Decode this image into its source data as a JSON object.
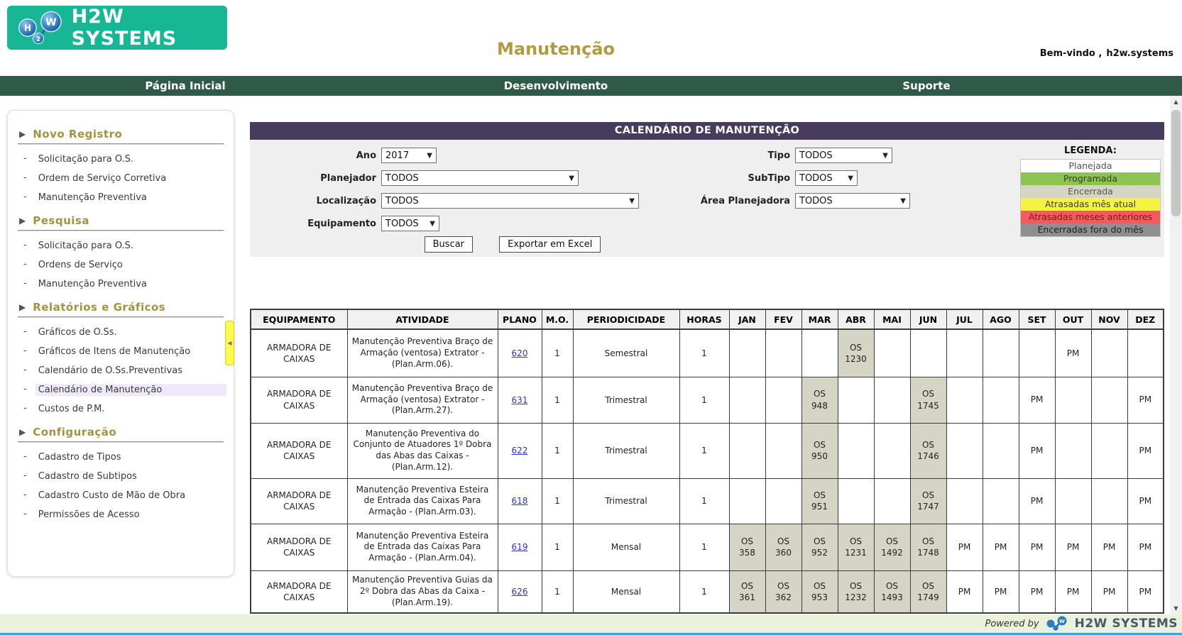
{
  "header": {
    "logo_text": "H2W SYSTEMS",
    "title": "Manutenção",
    "welcome_label": "Bem-vindo ,",
    "username": "h2w.systems"
  },
  "nav": {
    "items": [
      "Página Inicial",
      "Desenvolvimento",
      "Suporte"
    ]
  },
  "sidebar": {
    "sections": [
      {
        "title": "Novo Registro",
        "items": [
          "Solicitação para O.S.",
          "Ordem de Serviço Corretiva",
          "Manutenção Preventiva"
        ]
      },
      {
        "title": "Pesquisa",
        "items": [
          "Solicitação para O.S.",
          "Ordens de Serviço",
          "Manutenção Preventiva"
        ]
      },
      {
        "title": "Relatórios e Gráficos",
        "items": [
          "Gráficos de O.Ss.",
          "Gráficos de Itens de Manutenção",
          "Calendário de O.Ss.Preventivas",
          "Calendário de Manutenção",
          "Custos de P.M."
        ],
        "active": "Calendário de Manutenção"
      },
      {
        "title": "Configuração",
        "items": [
          "Cadastro de Tipos",
          "Cadastro de Subtipos",
          "Cadastro Custo de Mão de Obra",
          "Permissões de Acesso"
        ]
      }
    ]
  },
  "calendar": {
    "title": "CALENDÁRIO DE MANUTENÇÃO",
    "filters_left": [
      {
        "label": "Ano",
        "value": "2017"
      },
      {
        "label": "Planejador",
        "value": "TODOS"
      },
      {
        "label": "Localização",
        "value": "TODOS"
      },
      {
        "label": "Equipamento",
        "value": "TODOS"
      }
    ],
    "filters_right": [
      {
        "label": "Tipo",
        "value": "TODOS"
      },
      {
        "label": "SubTipo",
        "value": "TODOS"
      },
      {
        "label": "Área Planejadora",
        "value": "TODOS"
      }
    ],
    "buttons": {
      "search": "Buscar",
      "export": "Exportar em Excel"
    },
    "legend": {
      "title": "LEGENDA:",
      "items": [
        {
          "label": "Planejada",
          "bg": "#FFFFFF",
          "fg": "#555555"
        },
        {
          "label": "Programada",
          "bg": "#8DC351",
          "fg": "#3A3A3A"
        },
        {
          "label": "Encerrada",
          "bg": "#D5D4C5",
          "fg": "#555555"
        },
        {
          "label": "Atrasadas mês atual",
          "bg": "#F5F244",
          "fg": "#3A3A3A"
        },
        {
          "label": "Atrasadas meses anteriores",
          "bg": "#F25B5B",
          "fg": "#7D1A1A"
        },
        {
          "label": "Encerradas fora do mês",
          "bg": "#8F8F8F",
          "fg": "#1F1F1F"
        }
      ]
    },
    "table": {
      "columns": [
        "EQUIPAMENTO",
        "ATIVIDADE",
        "PLANO",
        "M.O.",
        "PERIODICIDADE",
        "HORAS"
      ],
      "months": [
        "JAN",
        "FEV",
        "MAR",
        "ABR",
        "MAI",
        "JUN",
        "JUL",
        "AGO",
        "SET",
        "OUT",
        "NOV",
        "DEZ"
      ],
      "rows": [
        {
          "equipamento": "ARMADORA DE CAIXAS",
          "atividade": "Manutenção Preventiva Braço de Armação (ventosa) Extrator - (Plan.Arm.06).",
          "plano": "620",
          "mo": "1",
          "periodicidade": "Semestral",
          "horas": "1",
          "meses": [
            "",
            "",
            "",
            "OS 1230",
            "",
            "",
            "",
            "",
            "",
            "PM",
            "",
            ""
          ]
        },
        {
          "equipamento": "ARMADORA DE CAIXAS",
          "atividade": "Manutenção Preventiva Braço de Armação (ventosa) Extrator - (Plan.Arm.27).",
          "plano": "631",
          "mo": "1",
          "periodicidade": "Trimestral",
          "horas": "1",
          "meses": [
            "",
            "",
            "OS 948",
            "",
            "",
            "OS 1745",
            "",
            "",
            "PM",
            "",
            "",
            "PM"
          ]
        },
        {
          "equipamento": "ARMADORA DE CAIXAS",
          "atividade": "Manutenção Preventiva do Conjunto de Atuadores 1º Dobra das Abas das Caixas - (Plan.Arm.12).",
          "plano": "622",
          "mo": "1",
          "periodicidade": "Trimestral",
          "horas": "1",
          "meses": [
            "",
            "",
            "OS 950",
            "",
            "",
            "OS 1746",
            "",
            "",
            "PM",
            "",
            "",
            "PM"
          ]
        },
        {
          "equipamento": "ARMADORA DE CAIXAS",
          "atividade": "Manutenção Preventiva Esteira de Entrada das Caixas Para Armação - (Plan.Arm.03).",
          "plano": "618",
          "mo": "1",
          "periodicidade": "Trimestral",
          "horas": "1",
          "meses": [
            "",
            "",
            "OS 951",
            "",
            "",
            "OS 1747",
            "",
            "",
            "PM",
            "",
            "",
            "PM"
          ]
        },
        {
          "equipamento": "ARMADORA DE CAIXAS",
          "atividade": "Manutenção Preventiva Esteira de Entrada das Caixas Para Armação - (Plan.Arm.04).",
          "plano": "619",
          "mo": "1",
          "periodicidade": "Mensal",
          "horas": "1",
          "meses": [
            "OS 358",
            "OS 360",
            "OS 952",
            "OS 1231",
            "OS 1492",
            "OS 1748",
            "PM",
            "PM",
            "PM",
            "PM",
            "PM",
            "PM"
          ]
        },
        {
          "equipamento": "ARMADORA DE CAIXAS",
          "atividade": "Manutenção Preventiva Guias da 2º Dobra das Abas da Caixa - (Plan.Arm.19).",
          "plano": "626",
          "mo": "1",
          "periodicidade": "Mensal",
          "horas": "1",
          "meses": [
            "OS 361",
            "OS 362",
            "OS 953",
            "OS 1232",
            "OS 1493",
            "OS 1749",
            "PM",
            "PM",
            "PM",
            "PM",
            "PM",
            "PM"
          ]
        }
      ]
    }
  },
  "footer": {
    "powered_by": "Powered by",
    "brand": "H2W SYSTEMS"
  }
}
